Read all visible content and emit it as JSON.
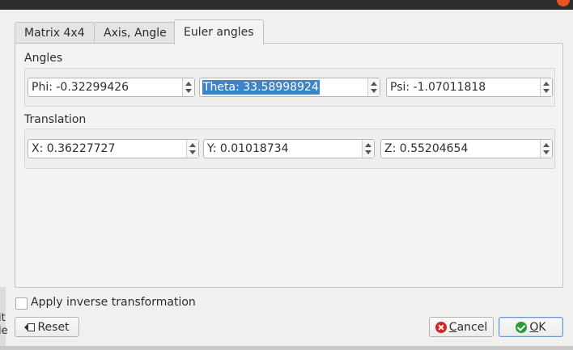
{
  "tabs": [
    {
      "label": "Matrix 4x4",
      "active": false
    },
    {
      "label": "Axis, Angle",
      "active": false
    },
    {
      "label": "Euler angles",
      "active": true
    }
  ],
  "angles": {
    "title": "Angles",
    "phi": "Phi: -0.32299426",
    "theta": "Theta: 33.58998924",
    "psi": "Psi: -1.07011818"
  },
  "translation": {
    "title": "Translation",
    "x": "X: 0.36227727",
    "y": "Y: 0.01018734",
    "z": "Z: 0.55204654"
  },
  "apply_inverse": {
    "label": "Apply inverse transformation",
    "checked": false
  },
  "buttons": {
    "reset": "Reset",
    "cancel_prefix": "",
    "cancel_mnemonic": "C",
    "cancel_rest": "ancel",
    "ok_mnemonic": "O",
    "ok_rest": "K"
  },
  "background_window": {
    "text_line1": "it",
    "text_line2": "le"
  },
  "colors": {
    "accent_close": "#e95420",
    "selection": "#3d84c9",
    "cancel_icon": "#d42424",
    "ok_icon": "#2e9a36"
  },
  "icons": {
    "reset": "reset-backspace-icon",
    "cancel": "cancel-circle-icon",
    "ok": "ok-check-icon"
  }
}
